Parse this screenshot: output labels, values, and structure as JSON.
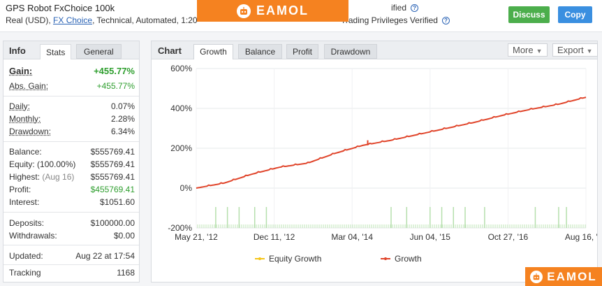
{
  "header": {
    "title": "GPS Robot FxChoice 100k",
    "sub_prefix": "Real (USD),",
    "broker_link": "FX Choice",
    "sub_suffix": ", Technical, Automated, 1:20",
    "verified_1": "ified",
    "verified_2": "Trading Privileges Verified",
    "discuss_label": "Discuss",
    "copy_label": "Copy"
  },
  "brand": {
    "name": "EAMOL",
    "color": "#f58220"
  },
  "info_tabs": {
    "title": "Info",
    "stats": "Stats",
    "general": "General"
  },
  "info": {
    "gain_label": "Gain:",
    "gain_value": "+455.77%",
    "abs_gain_label": "Abs. Gain:",
    "abs_gain_value": "+455.77%",
    "daily_label": "Daily:",
    "daily_value": "0.07%",
    "monthly_label": "Monthly:",
    "monthly_value": "2.28%",
    "drawdown_label": "Drawdown:",
    "drawdown_value": "6.34%",
    "balance_label": "Balance:",
    "balance_value": "$555769.41",
    "equity_label": "Equity:",
    "equity_pct": "(100.00%)",
    "equity_value": "$555769.41",
    "highest_label": "Highest:",
    "highest_date": "(Aug 16)",
    "highest_value": "$555769.41",
    "profit_label": "Profit:",
    "profit_value": "$455769.41",
    "interest_label": "Interest:",
    "interest_value": "$1051.60",
    "deposits_label": "Deposits:",
    "deposits_value": "$100000.00",
    "withdrawals_label": "Withdrawals:",
    "withdrawals_value": "$0.00",
    "updated_label": "Updated:",
    "updated_value": "Aug 22 at 17:54",
    "tracking_label": "Tracking",
    "tracking_value": "1168"
  },
  "chart_tabs": {
    "title": "Chart",
    "tabs": [
      "Growth",
      "Balance",
      "Profit",
      "Drawdown"
    ],
    "active": "Growth",
    "more": "More",
    "export": "Export"
  },
  "chart_data": {
    "type": "line",
    "x_ticks": [
      "May 21, '12",
      "Dec 11, '12",
      "Mar 04, '14",
      "Jun 04, '15",
      "Oct 27, '16",
      "Aug 16, '18"
    ],
    "y_ticks": [
      "600%",
      "400%",
      "200%",
      "0%",
      "-200%"
    ],
    "ylim": [
      -200,
      600
    ],
    "grid": true,
    "legend_position": "bottom",
    "series": [
      {
        "name": "Equity Growth",
        "color": "#f5c518",
        "x": [
          "May 21, '12",
          "Aug 16, '18"
        ],
        "values": [
          0,
          455.77
        ]
      },
      {
        "name": "Growth",
        "color": "#e0442a",
        "x": [
          "May 21, '12",
          "Jul 2012",
          "Sep 2012",
          "Nov 2012",
          "Dec 11, '12",
          "Jun 2013",
          "Oct 2013",
          "Mar 04, '14",
          "Dec 2014",
          "Jun 04, '15",
          "Jan 2016",
          "Oct 27, '16",
          "Jun 2017",
          "Jan 2018",
          "Aug 16, '18"
        ],
        "values": [
          0,
          25,
          70,
          105,
          125,
          175,
          215,
          240,
          270,
          300,
          330,
          365,
          395,
          420,
          455.77
        ]
      }
    ]
  }
}
